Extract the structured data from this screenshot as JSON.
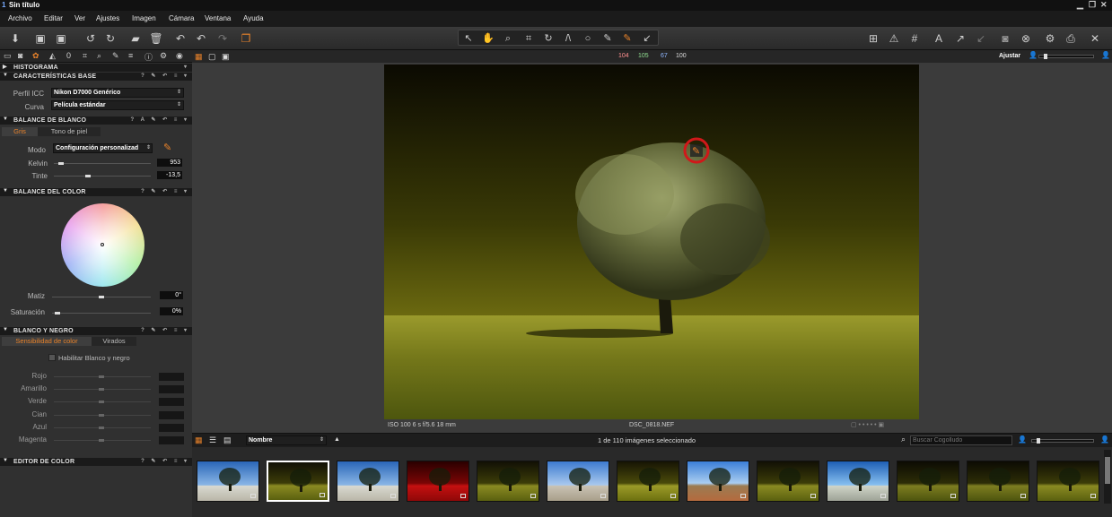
{
  "window": {
    "title": "Sin título"
  },
  "menu": [
    "Archivo",
    "Editar",
    "Ver",
    "Ajustes",
    "Imagen",
    "Cámara",
    "Ventana",
    "Ayuda"
  ],
  "colors": {
    "accent": "#e8822a",
    "highlight": "#d0181a",
    "panel": "#303030",
    "header": "#1a1a1a"
  },
  "pixel_readout": {
    "r": "104",
    "g": "105",
    "b": "67",
    "l": "100"
  },
  "zoom": {
    "label": "Ajustar"
  },
  "sections": {
    "histograma": "HISTOGRAMA",
    "caracteristicas": "CARACTERÍSTICAS BASE",
    "balance_blanco": "BALANCE DE BLANCO",
    "balance_color": "BALANCE DEL COLOR",
    "blanco_negro": "BLANCO Y NEGRO",
    "editor_color": "EDITOR DE COLOR"
  },
  "base": {
    "perfil_label": "Perfil ICC",
    "perfil_value": "Nikon D7000 Genérico",
    "curva_label": "Curva",
    "curva_value": "Película estándar"
  },
  "wb": {
    "tab_gris": "Gris",
    "tab_piel": "Tono de piel",
    "modo_label": "Modo",
    "modo_value": "Configuración personalizad",
    "kelvin_label": "Kelvin",
    "kelvin_value": "953",
    "kelvin_pos": 0.07,
    "tinte_label": "Tinte",
    "tinte_value": "-13,5",
    "tinte_pos": 0.35
  },
  "colorbal": {
    "matiz_label": "Matiz",
    "matiz_value": "0°",
    "matiz_pos": 0.5,
    "sat_label": "Saturación",
    "sat_value": "0%",
    "sat_pos": 0.05
  },
  "bw": {
    "tab_sens": "Sensibilidad de color",
    "tab_virados": "Virados",
    "enable_label": "Habilitar Blanco y negro",
    "channels": [
      "Rojo",
      "Amarillo",
      "Verde",
      "Cian",
      "Azul",
      "Magenta"
    ]
  },
  "photo": {
    "info": "ISO 100  6 s  f/5.6  18 mm",
    "filename": "DSC_0818.NEF"
  },
  "browser": {
    "sort": "Nombre",
    "status": "1 de 110 imágenes seleccionado",
    "search_placeholder": "Buscar Cogolludo"
  },
  "thumbnails": [
    {
      "kind": "blue",
      "selected": false
    },
    {
      "kind": "yellow",
      "selected": true
    },
    {
      "kind": "blue",
      "selected": false
    },
    {
      "kind": "red",
      "selected": false
    },
    {
      "kind": "yellow",
      "selected": false
    },
    {
      "kind": "sky",
      "selected": false
    },
    {
      "kind": "yellow2",
      "selected": false
    },
    {
      "kind": "road",
      "selected": false
    },
    {
      "kind": "yellow",
      "selected": false
    },
    {
      "kind": "blue2",
      "selected": false
    },
    {
      "kind": "dark",
      "selected": false
    },
    {
      "kind": "dark",
      "selected": false
    },
    {
      "kind": "yellow",
      "selected": false
    }
  ]
}
